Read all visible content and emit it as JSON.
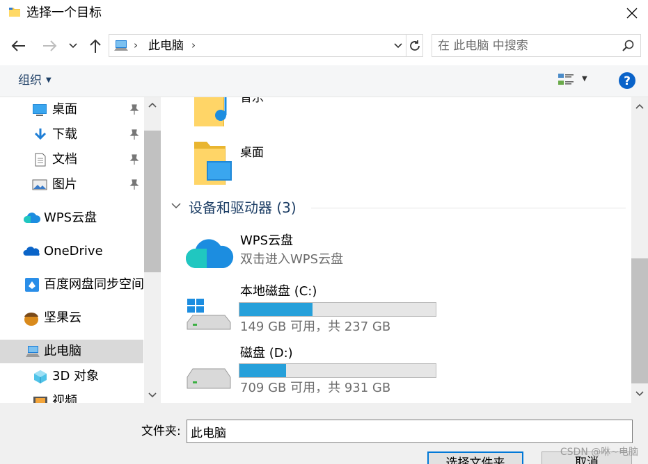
{
  "window": {
    "title": "选择一个目标"
  },
  "address": {
    "crumb": "此电脑"
  },
  "search": {
    "placeholder": "在 此电脑 中搜索"
  },
  "toolbar": {
    "organize_label": "组织"
  },
  "nav": {
    "items": [
      {
        "label": "桌面",
        "icon": "desktop-icon",
        "pinned": true
      },
      {
        "label": "下载",
        "icon": "download-icon",
        "pinned": true
      },
      {
        "label": "文档",
        "icon": "document-icon",
        "pinned": true
      },
      {
        "label": "图片",
        "icon": "picture-icon",
        "pinned": true
      },
      {
        "label": "WPS云盘",
        "icon": "wps-cloud-icon"
      },
      {
        "label": "OneDrive",
        "icon": "onedrive-icon"
      },
      {
        "label": "百度网盘同步空间",
        "icon": "baidu-netdisk-icon"
      },
      {
        "label": "坚果云",
        "icon": "nutstore-icon"
      },
      {
        "label": "此电脑",
        "icon": "this-pc-icon",
        "selected": true
      },
      {
        "label": "3D 对象",
        "icon": "3d-objects-icon"
      },
      {
        "label": "视频",
        "icon": "video-icon"
      }
    ]
  },
  "content": {
    "folders": [
      {
        "name": "音乐",
        "icon": "music-folder-icon"
      },
      {
        "name": "桌面",
        "icon": "desktop-folder-icon"
      }
    ],
    "group_title": "设备和驱动器 (3)",
    "drives": [
      {
        "name": "WPS云盘",
        "subtitle": "双击进入WPS云盘",
        "icon": "wps-cloud-drive-icon"
      },
      {
        "name": "本地磁盘 (C:)",
        "subtitle": "149 GB 可用，共 237 GB",
        "used_fraction": 0.371,
        "icon": "windows-drive-icon"
      },
      {
        "name": "磁盘 (D:)",
        "subtitle": "709 GB 可用，共 931 GB",
        "used_fraction": 0.238,
        "icon": "hard-drive-icon"
      }
    ]
  },
  "footer": {
    "folder_label": "文件夹:",
    "folder_value": "此电脑",
    "select_button": "选择文件夹",
    "cancel_button": "取消",
    "watermark": "CSDN @咻~电脑"
  },
  "colors": {
    "accent": "#0078d7",
    "bar_fill": "#26a0da",
    "link": "#1e3f66"
  }
}
